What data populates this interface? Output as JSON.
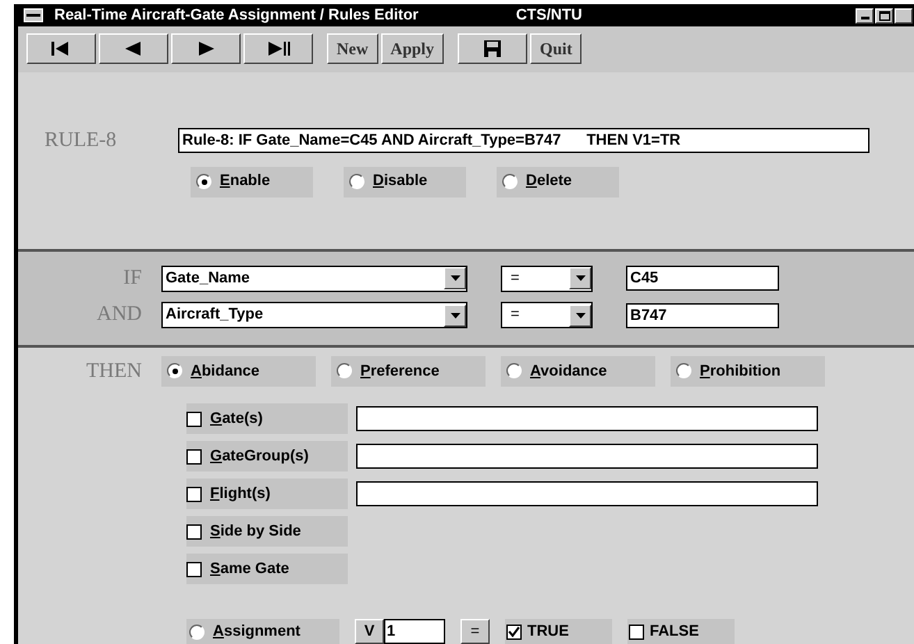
{
  "window": {
    "title": "Real-Time Aircraft-Gate Assignment / Rules Editor",
    "subtitle": "CTS/NTU"
  },
  "toolbar": [
    {
      "kind": "first"
    },
    {
      "kind": "prev"
    },
    {
      "kind": "next"
    },
    {
      "kind": "last"
    },
    {
      "kind": "text",
      "label": "New"
    },
    {
      "kind": "text",
      "label": "Apply"
    },
    {
      "kind": "save"
    },
    {
      "kind": "text",
      "label": "Quit"
    }
  ],
  "rule": {
    "label": "RULE-8",
    "text": "Rule-8: IF Gate_Name=C45 AND Aircraft_Type=B747      THEN V1=TR",
    "status": [
      {
        "label": "Enable",
        "selected": true
      },
      {
        "label": "Disable",
        "selected": false
      },
      {
        "label": "Delete",
        "selected": false
      }
    ]
  },
  "conditions": [
    {
      "keyword": "IF",
      "attribute": "Gate_Name",
      "operator": "=",
      "value": "C45"
    },
    {
      "keyword": "AND",
      "attribute": "Aircraft_Type",
      "operator": "=",
      "value": "B747"
    }
  ],
  "then": {
    "keyword": "THEN",
    "modes": [
      {
        "label": "Abidance",
        "selected": true
      },
      {
        "label": "Preference",
        "selected": false
      },
      {
        "label": "Avoidance",
        "selected": false
      },
      {
        "label": "Prohibition",
        "selected": false
      }
    ],
    "targets": [
      {
        "kind": "field",
        "label": "Gate(s)",
        "checked": false
      },
      {
        "kind": "field",
        "label": "GateGroup(s)",
        "checked": false
      },
      {
        "kind": "field",
        "label": "Flight(s)",
        "checked": false
      },
      {
        "kind": "plain",
        "label": "Side by Side",
        "checked": false
      },
      {
        "kind": "plain",
        "label": "Same Gate",
        "checked": false
      }
    ],
    "assignment": {
      "label": "Assignment",
      "selected": false,
      "variable": "V",
      "index": "1",
      "operator": "=",
      "options": [
        {
          "label": "TRUE",
          "checked": true
        },
        {
          "label": "FALSE",
          "checked": false
        }
      ]
    }
  }
}
